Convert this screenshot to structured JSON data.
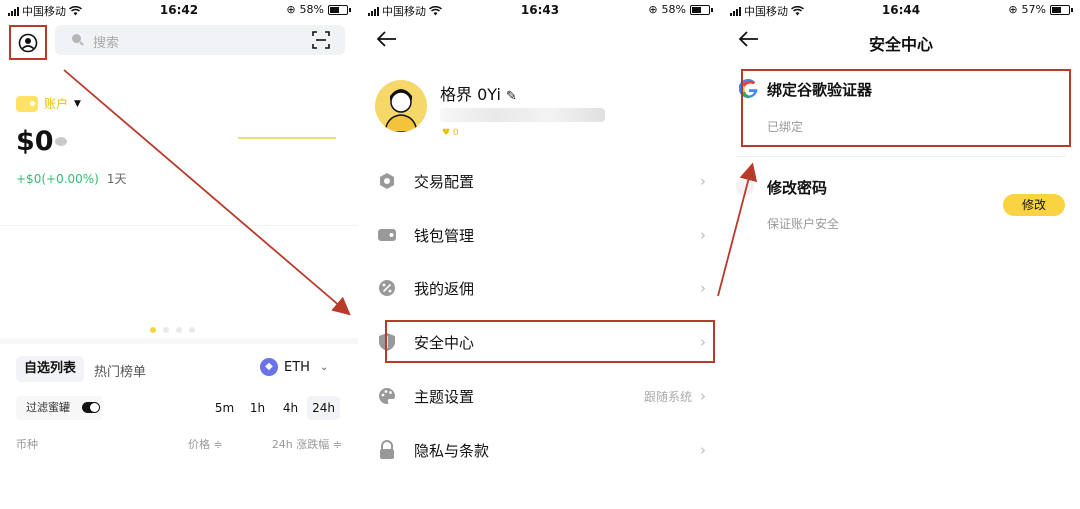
{
  "screen1": {
    "status": {
      "carrier": "中国移动",
      "time": "16:42",
      "battery": "58%",
      "battery_level": 0.58
    },
    "search": {
      "placeholder": "搜索"
    },
    "account": {
      "label": "账户",
      "balance": "$0",
      "change": "+$0(+0.00%)",
      "period": "1天"
    },
    "carousel": {
      "pages": 4,
      "active": 0
    },
    "tabs": [
      "自选列表",
      "热门榜单"
    ],
    "coin": "ETH",
    "filter_label": "过滤蜜罐",
    "periods": [
      "5m",
      "1h",
      "4h",
      "24h"
    ],
    "selected_period": "24h",
    "columns": [
      "币种",
      "价格 ≑",
      "24h 涨跌幅 ≑"
    ]
  },
  "screen2": {
    "status": {
      "carrier": "中国移动",
      "time": "16:43",
      "battery": "58%",
      "battery_level": 0.58
    },
    "profile": {
      "name": "格界 0Yi",
      "likes": "♥ 0"
    },
    "menu": [
      {
        "label": "交易配置",
        "icon": "hexagon-icon",
        "value": ""
      },
      {
        "label": "钱包管理",
        "icon": "wallet-icon",
        "value": ""
      },
      {
        "label": "我的返佣",
        "icon": "percent-icon",
        "value": ""
      },
      {
        "label": "安全中心",
        "icon": "shield-icon",
        "value": ""
      },
      {
        "label": "主题设置",
        "icon": "palette-icon",
        "value": "跟随系统"
      },
      {
        "label": "隐私与条款",
        "icon": "lock-icon",
        "value": ""
      }
    ]
  },
  "screen3": {
    "status": {
      "carrier": "中国移动",
      "time": "16:44",
      "battery": "57%",
      "battery_level": 0.57
    },
    "title": "安全中心",
    "google_auth": {
      "title": "绑定谷歌验证器",
      "status": "已绑定"
    },
    "password": {
      "title": "修改密码",
      "subtitle": "保证账户安全",
      "button": "修改"
    }
  },
  "colors": {
    "accent": "#f9d341",
    "annotation": "#b83a2b",
    "positive": "#2fbf71"
  }
}
